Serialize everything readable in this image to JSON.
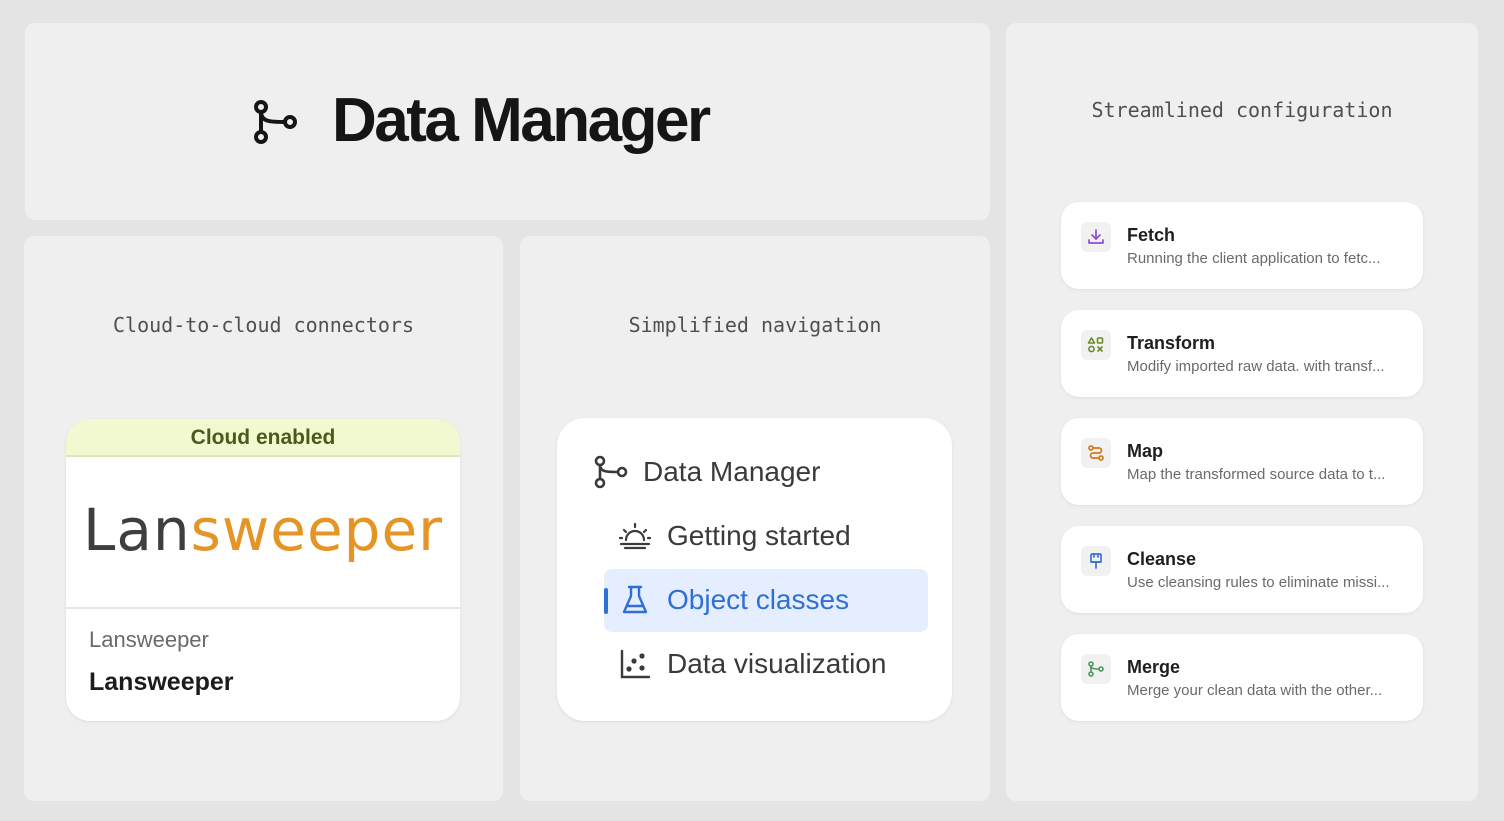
{
  "hero": {
    "title": "Data Manager",
    "icon": "branch-icon"
  },
  "connectors": {
    "heading": "Cloud-to-cloud connectors",
    "card": {
      "badge": "Cloud enabled",
      "logo_text_dark": "Lan",
      "logo_text_accent": "sweeper",
      "vendor": "Lansweeper",
      "name": "Lansweeper"
    }
  },
  "navigation": {
    "heading": "Simplified navigation",
    "root": {
      "label": "Data Manager",
      "icon": "branch-icon"
    },
    "items": [
      {
        "label": "Getting started",
        "icon": "sunrise-icon",
        "active": false
      },
      {
        "label": "Object classes",
        "icon": "flask-icon",
        "active": true
      },
      {
        "label": "Data visualization",
        "icon": "scatter-chart-icon",
        "active": false
      }
    ]
  },
  "config": {
    "heading": "Streamlined configuration",
    "steps": [
      {
        "title": "Fetch",
        "description": "Running the client application to fetc...",
        "icon": "download-icon",
        "color": "#8a4fd3"
      },
      {
        "title": "Transform",
        "description": "Modify imported raw data. with transf...",
        "icon": "shapes-icon",
        "color": "#6a8a2a"
      },
      {
        "title": "Map",
        "description": "Map the transformed source data to t...",
        "icon": "route-icon",
        "color": "#d27a1e"
      },
      {
        "title": "Cleanse",
        "description": "Use cleansing rules to eliminate missi...",
        "icon": "brush-icon",
        "color": "#3a73d8"
      },
      {
        "title": "Merge",
        "description": "Merge your clean data with the other...",
        "icon": "merge-icon",
        "color": "#4a9a5a"
      }
    ]
  },
  "colors": {
    "accent_blue": "#2f6fd6",
    "logo_orange": "#e59426",
    "badge_bg": "#f2f8cf"
  }
}
